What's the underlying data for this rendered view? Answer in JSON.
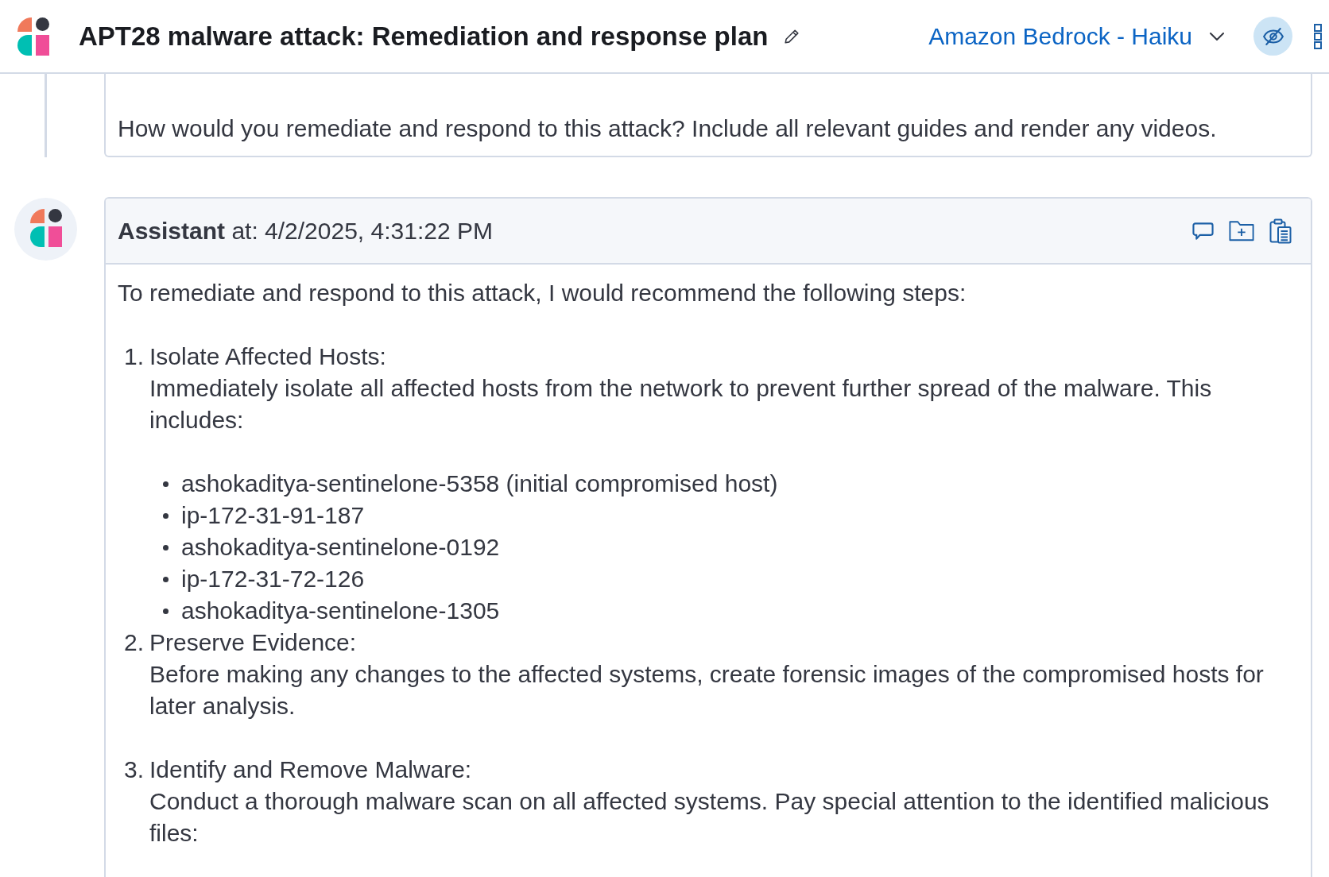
{
  "header": {
    "title": "APT28 malware attack: Remediation and response plan",
    "model_selector": {
      "label": "Amazon Bedrock - Haiku"
    },
    "eye_toggle": {
      "active": true
    }
  },
  "messages": [
    {
      "kind": "user",
      "text": "How would you remediate and respond to this attack? Include all relevant guides and render any videos."
    },
    {
      "kind": "assistant",
      "byline": "**Assistant** at: 4/2/2025, 4:31:22 PM",
      "intro": "To remediate and respond to this attack, I would recommend the following steps:",
      "steps": [
        {
          "number": "1.",
          "title": "Isolate Affected Hosts:",
          "description": "Immediately isolate all affected hosts from the network to prevent further spread of the malware. This includes:",
          "bullets": [
            "ashokaditya-sentinelone-5358 (initial compromised host)",
            "ip-172-31-91-187",
            "ashokaditya-sentinelone-0192",
            "ip-172-31-72-126",
            "ashokaditya-sentinelone-1305"
          ]
        },
        {
          "number": "2.",
          "title": "Preserve Evidence:",
          "description": "Before making any changes to the affected systems, create forensic images of the compromised hosts for later analysis."
        },
        {
          "number": "3.",
          "title": "Identify and Remove Malware:",
          "description": "Conduct a thorough malware scan on all affected systems. Pay special attention to the identified malicious files:"
        }
      ]
    }
  ]
}
